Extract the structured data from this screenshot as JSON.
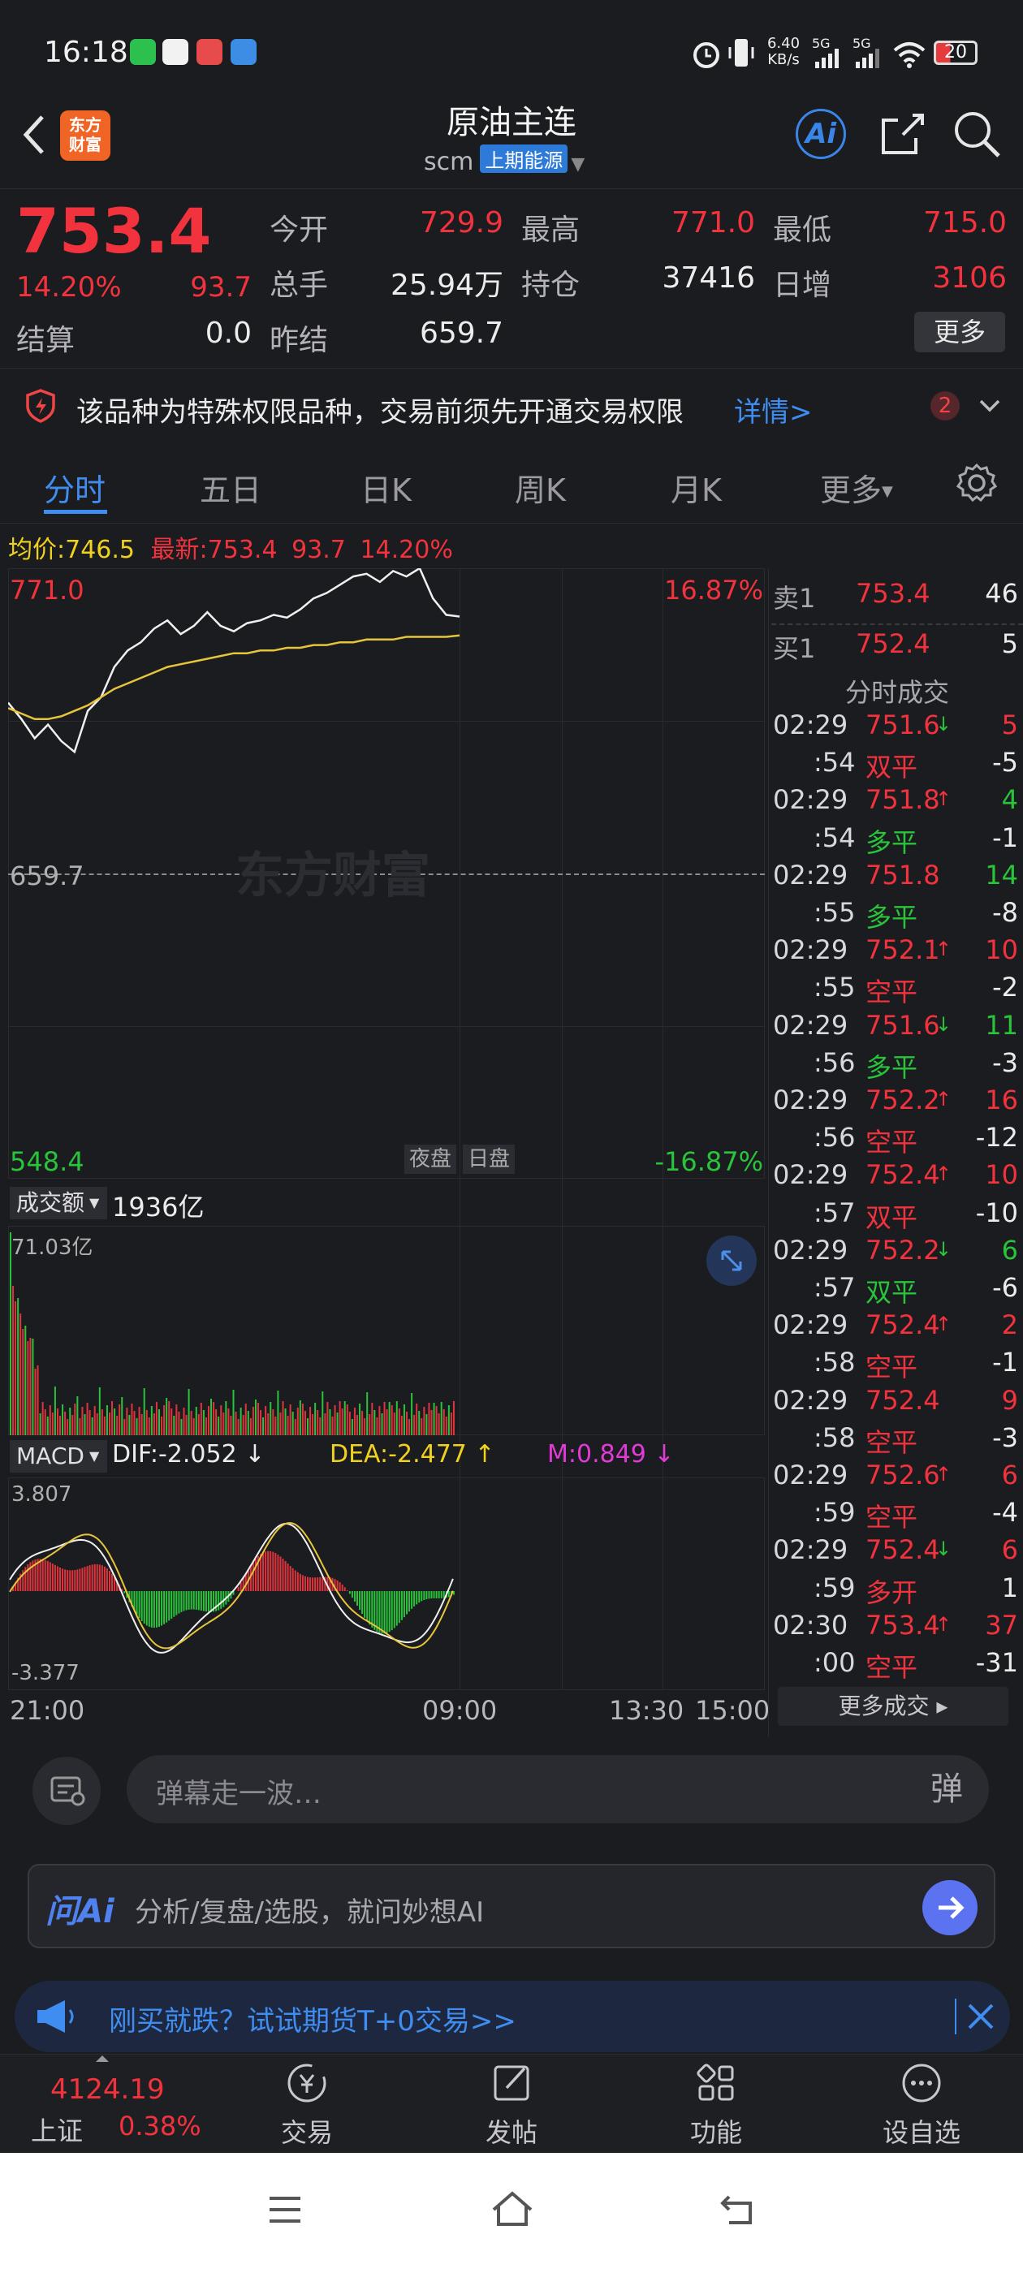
{
  "status_bar": {
    "time": "16:18",
    "net_speed_top": "6.40",
    "net_speed_unit": "KB/s",
    "sig1": "5G",
    "sig2": "5G",
    "battery": "20"
  },
  "header": {
    "logo_text_1": "东方",
    "logo_text_2": "财富",
    "title": "原油主连",
    "code": "scm",
    "exchange": "上期能源",
    "ai_label": "Ai"
  },
  "quote": {
    "price": "753.4",
    "change_pct": "14.20%",
    "change": "93.7",
    "settle_label": "结算",
    "settle": "0.0",
    "open_label": "今开",
    "open": "729.9",
    "high_label": "最高",
    "high": "771.0",
    "low_label": "最低",
    "low": "715.0",
    "volume_label": "总手",
    "volume": "25.94万",
    "oi_label": "持仓",
    "oi": "37416",
    "oi_change_label": "日增",
    "oi_change": "3106",
    "prev_settle_label": "昨结",
    "prev_settle": "659.7",
    "more_button": "更多"
  },
  "notice": {
    "text": "该品种为特殊权限品种，交易前须先开通交易权限",
    "link": "详情>",
    "count": "2"
  },
  "tabs": [
    "分时",
    "五日",
    "日K",
    "周K",
    "月K",
    "更多"
  ],
  "intraday": {
    "avg_label": "均价:",
    "avg": "746.5",
    "latest_label": "最新:",
    "latest": "753.4",
    "chg": "93.7",
    "pct": "14.20%",
    "y_top": "771.0",
    "y_mid": "659.7",
    "y_bottom": "548.4",
    "pct_top": "16.87%",
    "pct_bottom": "-16.87%",
    "session_night": "夜盘",
    "session_day": "日盘",
    "watermark": "东方财富",
    "turnover_label": "成交额",
    "turnover_total": "1936亿",
    "turnover_max": "71.03亿",
    "macd_label": "MACD",
    "dif": "DIF:-2.052 ↓",
    "dea": "DEA:-2.477 ↑",
    "m": "M:0.849 ↓",
    "macd_top": "3.807",
    "macd_bottom": "-3.377",
    "x_labels": [
      "21:00",
      "09:00",
      "13:30",
      "15:00"
    ]
  },
  "chart_data": {
    "type": "line",
    "title": "",
    "ylim": [
      548.4,
      771.0
    ],
    "series": [
      {
        "name": "最新",
        "values": [
          722,
          716,
          709,
          714,
          708,
          704,
          719,
          724,
          735,
          741,
          744,
          749,
          752,
          747,
          750,
          755,
          750,
          748,
          751,
          752,
          754,
          753,
          756,
          760,
          762,
          765,
          768,
          769,
          766,
          770,
          768,
          771,
          760,
          754,
          753.4
        ]
      },
      {
        "name": "均价",
        "values": [
          720,
          718,
          716,
          716,
          717,
          719,
          721,
          724,
          727,
          729,
          731,
          733,
          735,
          736,
          737,
          738,
          739,
          740,
          740,
          741,
          741,
          742,
          742,
          743,
          743,
          744,
          744,
          745,
          745,
          745,
          746,
          746,
          746,
          746,
          746.5
        ]
      }
    ]
  },
  "order_book": {
    "sell_label": "卖1",
    "sell_price": "753.4",
    "sell_vol": "46",
    "buy_label": "买1",
    "buy_price": "752.4",
    "buy_vol": "5",
    "trades_title": "分时成交",
    "trades": [
      {
        "t": "02:29",
        "p": "751.6",
        "arrow": "↓",
        "v": "5",
        "pc": "red",
        "vc": "red"
      },
      {
        "t": ":54",
        "p": "双平",
        "arrow": "",
        "v": "-5",
        "pc": "red",
        "vc": "white"
      },
      {
        "t": "02:29",
        "p": "751.8",
        "arrow": "↑",
        "v": "4",
        "pc": "red",
        "vc": "green"
      },
      {
        "t": ":54",
        "p": "多平",
        "arrow": "",
        "v": "-1",
        "pc": "green",
        "vc": "white"
      },
      {
        "t": "02:29",
        "p": "751.8",
        "arrow": "",
        "v": "14",
        "pc": "red",
        "vc": "green"
      },
      {
        "t": ":55",
        "p": "多平",
        "arrow": "",
        "v": "-8",
        "pc": "green",
        "vc": "white"
      },
      {
        "t": "02:29",
        "p": "752.1",
        "arrow": "↑",
        "v": "10",
        "pc": "red",
        "vc": "red"
      },
      {
        "t": ":55",
        "p": "空平",
        "arrow": "",
        "v": "-2",
        "pc": "red",
        "vc": "white"
      },
      {
        "t": "02:29",
        "p": "751.6",
        "arrow": "↓",
        "v": "11",
        "pc": "red",
        "vc": "green"
      },
      {
        "t": ":56",
        "p": "多平",
        "arrow": "",
        "v": "-3",
        "pc": "green",
        "vc": "white"
      },
      {
        "t": "02:29",
        "p": "752.2",
        "arrow": "↑",
        "v": "16",
        "pc": "red",
        "vc": "red"
      },
      {
        "t": ":56",
        "p": "空平",
        "arrow": "",
        "v": "-12",
        "pc": "red",
        "vc": "white"
      },
      {
        "t": "02:29",
        "p": "752.4",
        "arrow": "↑",
        "v": "10",
        "pc": "red",
        "vc": "red"
      },
      {
        "t": ":57",
        "p": "双平",
        "arrow": "",
        "v": "-10",
        "pc": "red",
        "vc": "white"
      },
      {
        "t": "02:29",
        "p": "752.2",
        "arrow": "↓",
        "v": "6",
        "pc": "red",
        "vc": "green"
      },
      {
        "t": ":57",
        "p": "双平",
        "arrow": "",
        "v": "-6",
        "pc": "green",
        "vc": "white"
      },
      {
        "t": "02:29",
        "p": "752.4",
        "arrow": "↑",
        "v": "2",
        "pc": "red",
        "vc": "red"
      },
      {
        "t": ":58",
        "p": "空平",
        "arrow": "",
        "v": "-1",
        "pc": "red",
        "vc": "white"
      },
      {
        "t": "02:29",
        "p": "752.4",
        "arrow": "",
        "v": "9",
        "pc": "red",
        "vc": "red"
      },
      {
        "t": ":58",
        "p": "空平",
        "arrow": "",
        "v": "-3",
        "pc": "red",
        "vc": "white"
      },
      {
        "t": "02:29",
        "p": "752.6",
        "arrow": "↑",
        "v": "6",
        "pc": "red",
        "vc": "red"
      },
      {
        "t": ":59",
        "p": "空平",
        "arrow": "",
        "v": "-4",
        "pc": "red",
        "vc": "white"
      },
      {
        "t": "02:29",
        "p": "752.4",
        "arrow": "↓",
        "v": "6",
        "pc": "red",
        "vc": "red"
      },
      {
        "t": ":59",
        "p": "多开",
        "arrow": "",
        "v": "1",
        "pc": "red",
        "vc": "white"
      },
      {
        "t": "02:30",
        "p": "753.4",
        "arrow": "↑",
        "v": "37",
        "pc": "red",
        "vc": "red"
      },
      {
        "t": ":00",
        "p": "空平",
        "arrow": "",
        "v": "-31",
        "pc": "red",
        "vc": "white"
      }
    ],
    "more_trades": "更多成交"
  },
  "danmu": {
    "placeholder": "弹幕走一波…",
    "button": "弹"
  },
  "ai_bar": {
    "badge": "问Ai",
    "placeholder": "分析/复盘/选股，就问妙想AI"
  },
  "promo": {
    "text": "刚买就跌？试试期货T+0交易>>"
  },
  "bottom_nav": {
    "index_value": "4124.19",
    "index_name": "上证",
    "index_pct": "0.38%",
    "items": [
      "交易",
      "发帖",
      "功能",
      "设自选"
    ]
  }
}
